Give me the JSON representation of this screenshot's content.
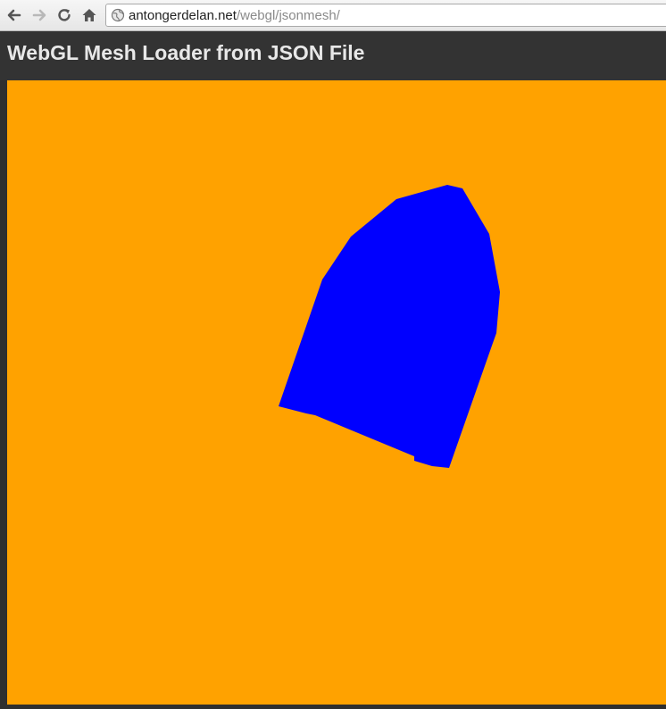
{
  "browser": {
    "url_host": "antongerdelan.net",
    "url_path": "/webgl/jsonmesh/"
  },
  "page": {
    "title": "WebGL Mesh Loader from JSON File"
  },
  "canvas": {
    "clear_color": "#ffa200",
    "mesh_color": "#0000ff"
  },
  "icons": {
    "back": "back-arrow-icon",
    "forward": "forward-arrow-icon",
    "reload": "reload-icon",
    "home": "home-icon",
    "site": "globe-icon"
  }
}
